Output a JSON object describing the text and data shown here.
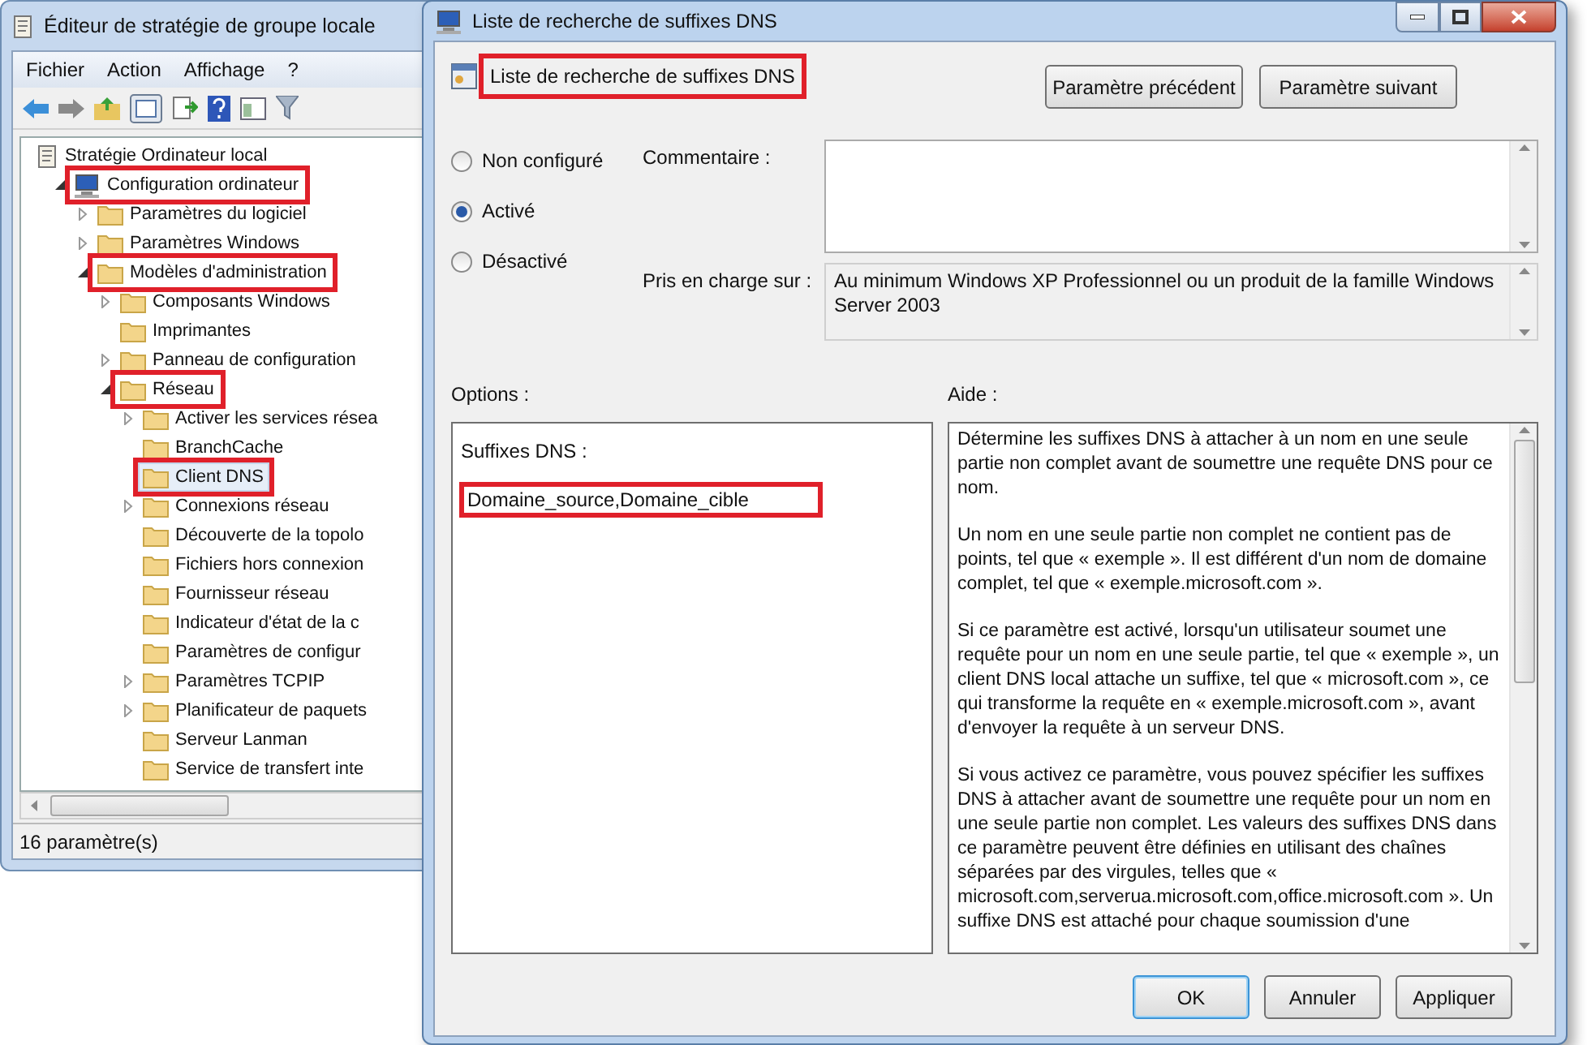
{
  "main_window": {
    "title": "Éditeur de stratégie de groupe locale",
    "menu": [
      "Fichier",
      "Action",
      "Affichage",
      "?"
    ],
    "tree": [
      {
        "label": "Stratégie Ordinateur local",
        "kind": "document",
        "children": [
          {
            "label": "Configuration ordinateur",
            "kind": "computer",
            "expanded": true,
            "highlighted": true,
            "children": [
              {
                "label": "Paramètres du logiciel",
                "expanded": false
              },
              {
                "label": "Paramètres Windows",
                "expanded": false
              },
              {
                "label": "Modèles d'administration",
                "expanded": true,
                "highlighted": true,
                "children": [
                  {
                    "label": "Composants Windows",
                    "expanded": false
                  },
                  {
                    "label": "Imprimantes"
                  },
                  {
                    "label": "Panneau de configuration",
                    "expanded": false
                  },
                  {
                    "label": "Réseau",
                    "expanded": true,
                    "highlighted": true,
                    "children": [
                      {
                        "label": "Activer les services résea",
                        "expanded": false
                      },
                      {
                        "label": "BranchCache"
                      },
                      {
                        "label": "Client DNS",
                        "selected": true,
                        "highlighted": true
                      },
                      {
                        "label": "Connexions réseau",
                        "expanded": false
                      },
                      {
                        "label": "Découverte de la topolo"
                      },
                      {
                        "label": "Fichiers hors connexion"
                      },
                      {
                        "label": "Fournisseur réseau"
                      },
                      {
                        "label": "Indicateur d'état de la c"
                      },
                      {
                        "label": "Paramètres de configur"
                      },
                      {
                        "label": "Paramètres TCPIP",
                        "expanded": false
                      },
                      {
                        "label": "Planificateur de paquets",
                        "expanded": false
                      },
                      {
                        "label": "Serveur Lanman"
                      },
                      {
                        "label": "Service de transfert inte"
                      }
                    ]
                  }
                ]
              }
            ]
          }
        ]
      }
    ],
    "status_bar": "16 paramètre(s)"
  },
  "dialog": {
    "title": "Liste de recherche de suffixes DNS",
    "heading": {
      "text": "Liste de recherche de suffixes DNS",
      "highlighted": true
    },
    "nav_buttons": [
      "Paramètre précédent",
      "Paramètre suivant"
    ],
    "states": [
      {
        "label": "Non configuré",
        "selected": false
      },
      {
        "label": "Activé",
        "selected": true
      },
      {
        "label": "Désactivé",
        "selected": false
      }
    ],
    "comment_label": "Commentaire :",
    "supported_label": "Pris en charge sur :",
    "supported_text": "Au minimum Windows XP Professionnel ou un produit de la famille Windows Server 2003",
    "options_label": "Options :",
    "help_label": "Aide :",
    "options": {
      "field_label": "Suffixes DNS :",
      "value": "Domaine_source,Domaine_cible",
      "highlighted": true
    },
    "help": [
      "Détermine les suffixes DNS à attacher à un nom en une seule partie non complet avant de soumettre une requête DNS pour ce nom.",
      "Un nom en une seule partie non complet ne contient pas de points, tel que « exemple ». Il est différent d'un nom de domaine complet, tel que « exemple.microsoft.com ».",
      "Si ce paramètre est activé, lorsqu'un utilisateur soumet une requête pour un nom en une seule partie, tel que « exemple », un client DNS local attache un suffixe, tel que « microsoft.com », ce qui transforme la requête en « exemple.microsoft.com », avant d'envoyer la requête à un serveur DNS.",
      "Si vous activez ce paramètre, vous pouvez spécifier les suffixes DNS à attacher avant de soumettre une requête pour un nom en une seule partie non complet. Les valeurs des suffixes DNS dans ce paramètre peuvent être définies en utilisant des chaînes séparées par des virgules, telles que « microsoft.com,serverua.microsoft.com,office.microsoft.com ». Un suffixe DNS est attaché pour chaque soumission d'une"
    ],
    "buttons": [
      {
        "label": "OK",
        "default": true
      },
      {
        "label": "Annuler",
        "default": false
      },
      {
        "label": "Appliquer",
        "default": false
      }
    ]
  }
}
